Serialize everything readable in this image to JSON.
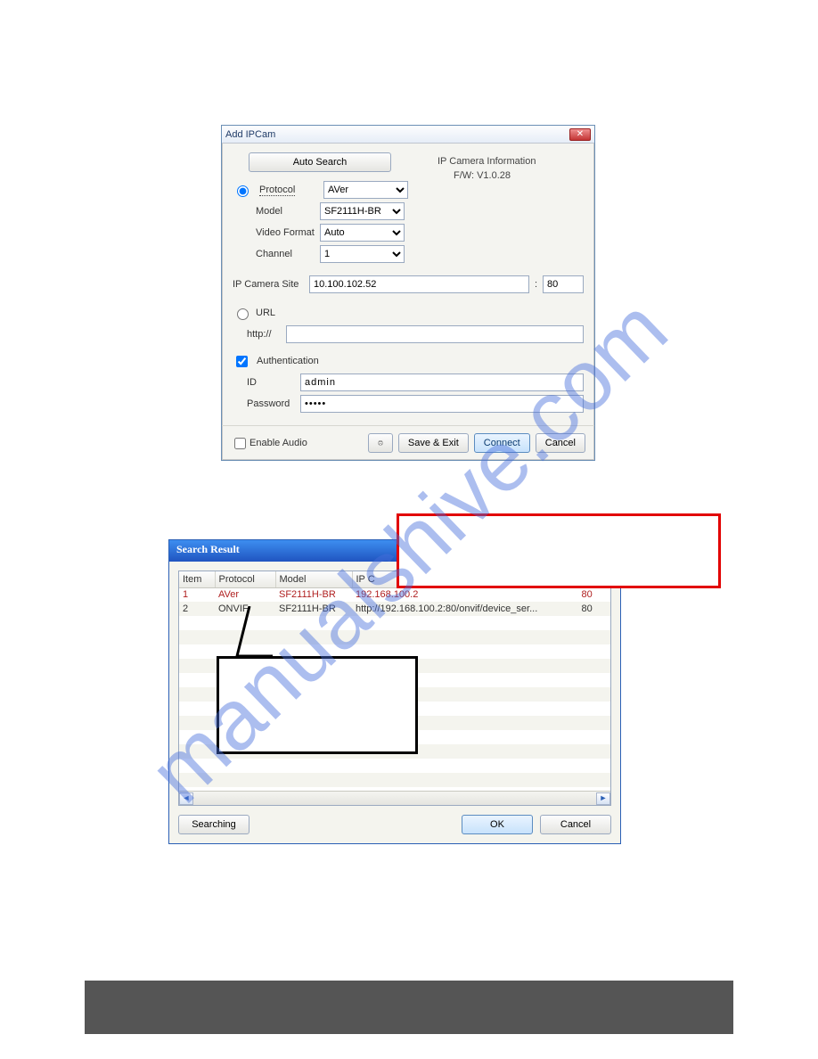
{
  "watermark": "manualshive.com",
  "dlg1": {
    "title": "Add IPCam",
    "auto_search": "Auto Search",
    "protocol_label": "Protocol",
    "protocol_value": "AVer",
    "model_label": "Model",
    "model_value": "SF2111H-BR",
    "video_format_label": "Video Format",
    "video_format_value": "Auto",
    "channel_label": "Channel",
    "channel_value": "1",
    "info_title": "IP Camera Information",
    "info_fw": "F/W: V1.0.28",
    "site_label": "IP Camera Site",
    "site_value": "10.100.102.52",
    "port_sep": ":",
    "port_value": "80",
    "url_label": "URL",
    "http_label": "http://",
    "http_value": "",
    "auth_label": "Authentication",
    "id_label": "ID",
    "id_value": "admin",
    "pw_label": "Password",
    "pw_value": "•••••",
    "enable_audio": "Enable Audio",
    "save_exit": "Save & Exit",
    "connect": "Connect",
    "cancel": "Cancel"
  },
  "dlg2": {
    "title": "Search Result",
    "cols": {
      "item": "Item",
      "protocol": "Protocol",
      "model": "Model",
      "ipcam": "IP C",
      "port": ""
    },
    "rows": [
      {
        "item": "1",
        "protocol": "AVer",
        "model": "SF2111H-BR",
        "ipcam": "192.168.100.2",
        "port": "80"
      },
      {
        "item": "2",
        "protocol": "ONVIF",
        "model": "SF2111H-BR",
        "ipcam": "http://192.168.100.2:80/onvif/device_ser...",
        "port": "80"
      }
    ],
    "searching": "Searching",
    "ok": "OK",
    "cancel": "Cancel"
  }
}
